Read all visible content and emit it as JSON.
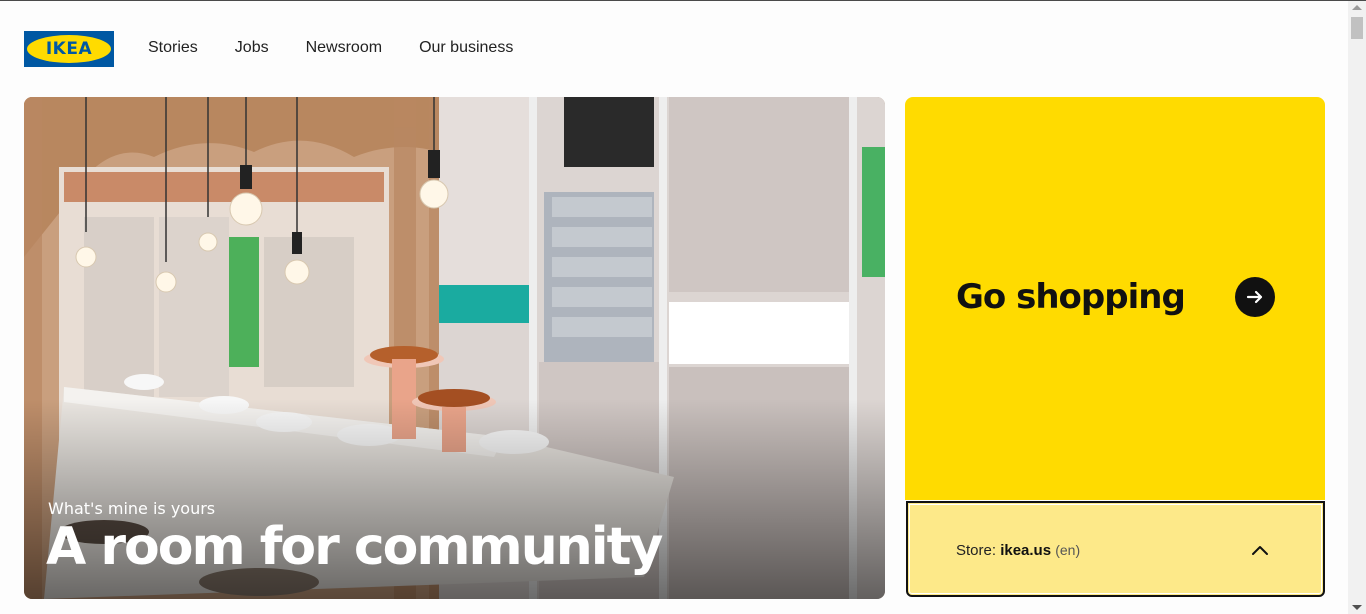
{
  "brand": {
    "logo_text": "IKEA",
    "blue": "#0058a3",
    "yellow": "#ffdb00"
  },
  "nav": {
    "items": [
      "Stories",
      "Jobs",
      "Newsroom",
      "Our business"
    ]
  },
  "hero": {
    "kicker": "What's mine is yours",
    "title": "A room for community"
  },
  "shop": {
    "title": "Go shopping",
    "arrow_icon": "arrow-right-icon",
    "background": "#ffdb00"
  },
  "store": {
    "label": "Store: ",
    "domain": "ikea.us",
    "language": "(en)",
    "chevron_icon": "chevron-up-icon",
    "background": "#fde989"
  }
}
